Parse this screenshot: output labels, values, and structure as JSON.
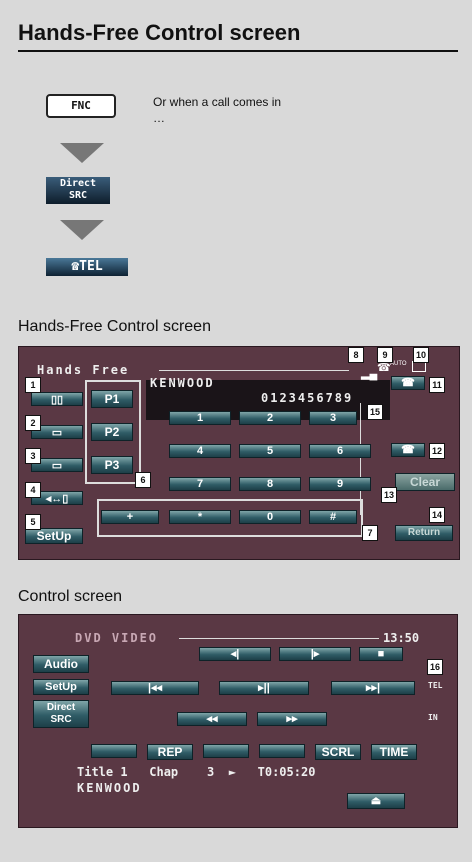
{
  "heading": "Hands-Free Control screen",
  "flow": {
    "fnc_key": "FNC",
    "call_note": "Or when a call comes in …",
    "direct_src_line1": "Direct",
    "direct_src_line2": "SRC",
    "tel_key": "☎TEL"
  },
  "handsfree": {
    "caption": "Hands-Free Control screen",
    "title": "Hands Free",
    "display_name": "KENWOOD",
    "display_number": "0123456789",
    "signal_icon": "antenna-icon",
    "auto_label": "AUTO",
    "presets": [
      "P1",
      "P2",
      "P3"
    ],
    "keypad": [
      "1",
      "2",
      "3",
      "4",
      "5",
      "6",
      "7",
      "8",
      "9",
      "+",
      "*",
      "0",
      "#"
    ],
    "setup": "SetUp",
    "clear": "Clear",
    "return": "Return",
    "callouts": [
      "1",
      "2",
      "3",
      "4",
      "5",
      "6",
      "7",
      "8",
      "9",
      "10",
      "11",
      "12",
      "13",
      "14",
      "15"
    ]
  },
  "control": {
    "caption": "Control screen",
    "source": "DVD VIDEO",
    "clock": "13:50",
    "audio": "Audio",
    "setup": "SetUp",
    "direct1": "Direct",
    "direct2": "SRC",
    "rep": "REP",
    "scrl": "SCRL",
    "time": "TIME",
    "tel_ind": "TEL",
    "in_ind": "IN",
    "status_line": "Title 1   Chap    3  ►   T0:05:20",
    "status_line2": "KENWOOD",
    "callout": "16"
  }
}
